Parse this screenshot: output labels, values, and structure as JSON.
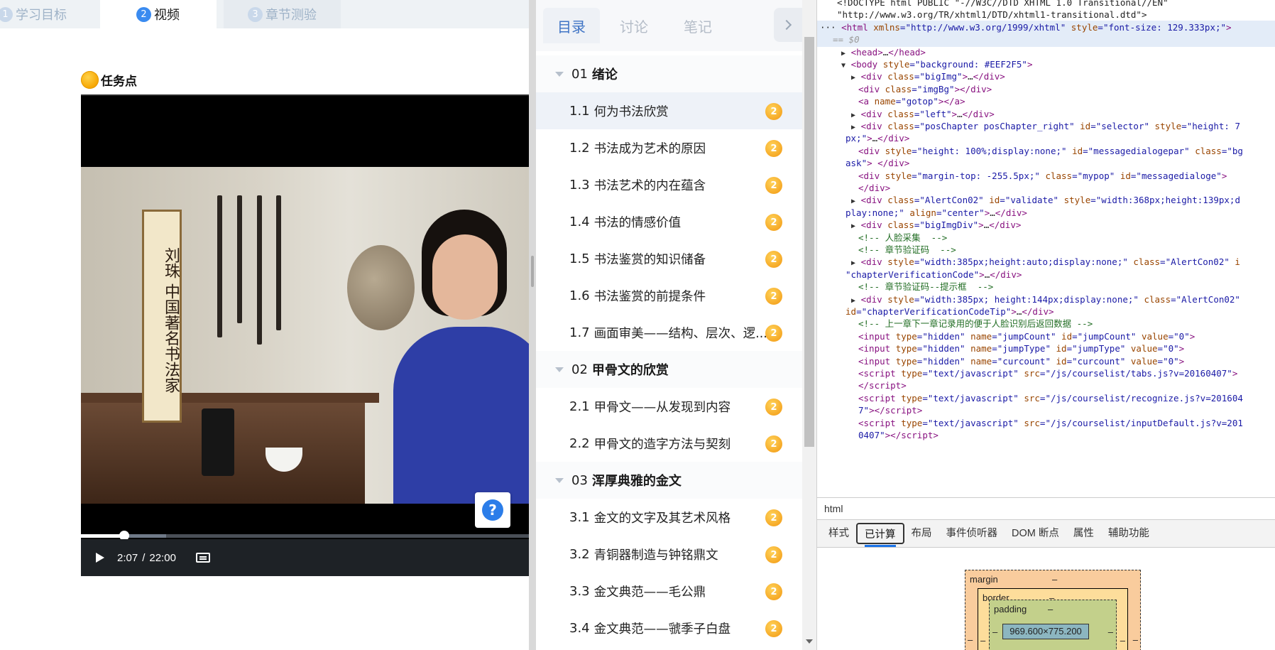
{
  "course_tabs": [
    {
      "num": "1",
      "label": "学习目标"
    },
    {
      "num": "2",
      "label": "视频"
    },
    {
      "num": "3",
      "label": "章节测验"
    }
  ],
  "task_point": {
    "label": "任务点"
  },
  "video_scroll_text": "刘珠 中国著名书法家",
  "player": {
    "current_time": "2:07",
    "separator": "/",
    "duration": "22:00",
    "played_fraction": 0.096,
    "buffered_fraction": 0.19,
    "help_label": "?",
    "icons": {
      "play": "play-icon",
      "subtitles": "subtitles-icon",
      "help": "help-icon"
    }
  },
  "catalog": {
    "tabs": [
      "目录",
      "讨论",
      "笔记"
    ],
    "active_tab": 0,
    "next_icon": "chevron-right-icon",
    "items": [
      {
        "type": "chapter",
        "num": "01",
        "name": "绪论"
      },
      {
        "type": "lesson",
        "num": "1.1",
        "name": "何为书法欣赏",
        "badge": "2",
        "active": true
      },
      {
        "type": "lesson",
        "num": "1.2",
        "name": "书法成为艺术的原因",
        "badge": "2"
      },
      {
        "type": "lesson",
        "num": "1.3",
        "name": "书法艺术的内在蕴含",
        "badge": "2"
      },
      {
        "type": "lesson",
        "num": "1.4",
        "name": "书法的情感价值",
        "badge": "2"
      },
      {
        "type": "lesson",
        "num": "1.5",
        "name": "书法鉴赏的知识储备",
        "badge": "2"
      },
      {
        "type": "lesson",
        "num": "1.6",
        "name": "书法鉴赏的前提条件",
        "badge": "2"
      },
      {
        "type": "lesson",
        "num": "1.7",
        "name": "画面审美——结构、层次、逻...",
        "badge": "2"
      },
      {
        "type": "chapter",
        "num": "02",
        "name": "甲骨文的欣赏"
      },
      {
        "type": "lesson",
        "num": "2.1",
        "name": "甲骨文——从发现到内容",
        "badge": "2"
      },
      {
        "type": "lesson",
        "num": "2.2",
        "name": "甲骨文的造字方法与契刻",
        "badge": "2"
      },
      {
        "type": "chapter",
        "num": "03",
        "name": "浑厚典雅的金文"
      },
      {
        "type": "lesson",
        "num": "3.1",
        "name": "金文的文字及其艺术风格",
        "badge": "2"
      },
      {
        "type": "lesson",
        "num": "3.2",
        "name": "青铜器制造与钟铭鼎文",
        "badge": "2"
      },
      {
        "type": "lesson",
        "num": "3.3",
        "name": "金文典范——毛公鼎",
        "badge": "2"
      },
      {
        "type": "lesson",
        "num": "3.4",
        "name": "金文典范——虢季子白盘",
        "badge": "2"
      }
    ]
  },
  "devtools": {
    "lines": [
      {
        "indent": 28,
        "html": "<span class='txt'>&lt;!DOCTYPE html PUBLIC \"-//W3C//DTD XHTML 1.0 Transitional//EN\"</span>"
      },
      {
        "indent": 28,
        "html": "<span class='txt'>\"http://www.w3.org/TR/xhtml1/DTD/xhtml1-transitional.dtd\"&gt;</span>"
      },
      {
        "indent": 4,
        "sel": true,
        "html": "<span class='txt'>··· </span><span class='tag'>&lt;html</span> <span class='attr'>xmlns</span>=<span class='val'>\"http://www.w3.org/1999/xhtml\"</span> <span class='attr'>style</span>=<span class='val'>\"font-size: 129.333px;\"</span><span class='tag'>&gt;</span>"
      },
      {
        "indent": 22,
        "sel": true,
        "html": "<span class='eqs'>== $0</span>"
      },
      {
        "indent": 34,
        "html": "<span class='tri'>▶</span> <span class='tag'>&lt;head&gt;</span><span class='txt'>…</span><span class='tag'>&lt;/head&gt;</span>"
      },
      {
        "indent": 34,
        "html": "<span class='tri'>▼</span> <span class='tag'>&lt;body</span> <span class='attr'>style</span>=<span class='val'>\"background: #EEF2F5\"</span><span class='tag'>&gt;</span>"
      },
      {
        "indent": 48,
        "html": "<span class='tri'>▶</span> <span class='tag'>&lt;div</span> <span class='attr'>class</span>=<span class='val'>\"bigImg\"</span><span class='tag'>&gt;</span><span class='txt'>…</span><span class='tag'>&lt;/div&gt;</span>"
      },
      {
        "indent": 58,
        "html": "<span class='tag'>&lt;div</span> <span class='attr'>class</span>=<span class='val'>\"imgBg\"</span><span class='tag'>&gt;&lt;/div&gt;</span>"
      },
      {
        "indent": 58,
        "html": "<span class='tag'>&lt;a</span> <span class='attr'>name</span>=<span class='val'>\"gotop\"</span><span class='tag'>&gt;&lt;/a&gt;</span>"
      },
      {
        "indent": 48,
        "html": "<span class='tri'>▶</span> <span class='tag'>&lt;div</span> <span class='attr'>class</span>=<span class='val'>\"left\"</span><span class='tag'>&gt;</span><span class='txt'>…</span><span class='tag'>&lt;/div&gt;</span>"
      },
      {
        "indent": 48,
        "html": "<span class='tri'>▶</span> <span class='tag'>&lt;div</span> <span class='attr'>class</span>=<span class='val'>\"posChapter posChapter_right\"</span> <span class='attr'>id</span>=<span class='val'>\"selector\"</span> <span class='attr'>style</span>=<span class='val'>\"height: 7</span>"
      },
      {
        "indent": 40,
        "html": "<span class='val'>px;\"</span><span class='tag'>&gt;</span><span class='txt'>…</span><span class='tag'>&lt;/div&gt;</span>"
      },
      {
        "indent": 58,
        "html": "<span class='tag'>&lt;div</span> <span class='attr'>style</span>=<span class='val'>\"height: 100%;display:none;\"</span> <span class='attr'>id</span>=<span class='val'>\"messagedialogepar\"</span> <span class='attr'>class</span>=<span class='val'>\"bg</span>"
      },
      {
        "indent": 40,
        "html": "<span class='val'>ask\"</span><span class='tag'>&gt; &lt;/div&gt;</span>"
      },
      {
        "indent": 58,
        "html": "<span class='tag'>&lt;div</span> <span class='attr'>style</span>=<span class='val'>\"margin-top: -255.5px;\"</span> <span class='attr'>class</span>=<span class='val'>\"mypop\"</span> <span class='attr'>id</span>=<span class='val'>\"messagedialoge\"</span><span class='tag'>&gt;</span>"
      },
      {
        "indent": 58,
        "html": "<span class='tag'>&lt;/div&gt;</span>"
      },
      {
        "indent": 48,
        "html": "<span class='tri'>▶</span> <span class='tag'>&lt;div</span> <span class='attr'>class</span>=<span class='val'>\"AlertCon02\"</span> <span class='attr'>id</span>=<span class='val'>\"validate\"</span> <span class='attr'>style</span>=<span class='val'>\"width:368px;height:139px;d</span>"
      },
      {
        "indent": 40,
        "html": "<span class='val'>play:none;\"</span> <span class='attr'>align</span>=<span class='val'>\"center\"</span><span class='tag'>&gt;</span><span class='txt'>…</span><span class='tag'>&lt;/div&gt;</span>"
      },
      {
        "indent": 48,
        "html": "<span class='tri'>▶</span> <span class='tag'>&lt;div</span> <span class='attr'>class</span>=<span class='val'>\"bigImgDiv\"</span><span class='tag'>&gt;</span><span class='txt'>…</span><span class='tag'>&lt;/div&gt;</span>"
      },
      {
        "indent": 58,
        "html": "<span class='cmt'>&lt;!-- 人脸采集  --&gt;</span>"
      },
      {
        "indent": 58,
        "html": "<span class='cmt'>&lt;!-- 章节验证码  --&gt;</span>"
      },
      {
        "indent": 48,
        "html": "<span class='tri'>▶</span> <span class='tag'>&lt;div</span> <span class='attr'>style</span>=<span class='val'>\"width:385px;height:auto;display:none;\"</span> <span class='attr'>class</span>=<span class='val'>\"AlertCon02\"</span> <span class='attr'>i</span>"
      },
      {
        "indent": 40,
        "html": "<span class='val'>\"chapterVerificationCode\"</span><span class='tag'>&gt;</span><span class='txt'>…</span><span class='tag'>&lt;/div&gt;</span>"
      },
      {
        "indent": 58,
        "html": "<span class='cmt'>&lt;!-- 章节验证码--提示框  --&gt;</span>"
      },
      {
        "indent": 48,
        "html": "<span class='tri'>▶</span> <span class='tag'>&lt;div</span> <span class='attr'>style</span>=<span class='val'>\"width:385px; height:144px;display:none;\"</span> <span class='attr'>class</span>=<span class='val'>\"AlertCon02\"</span>"
      },
      {
        "indent": 40,
        "html": "<span class='attr'>id</span>=<span class='val'>\"chapterVerificationCodeTip\"</span><span class='tag'>&gt;</span><span class='txt'>…</span><span class='tag'>&lt;/div&gt;</span>"
      },
      {
        "indent": 58,
        "html": "<span class='cmt'>&lt;!-- 上一章下一章记录用的便于人脸识别后返回数据 --&gt;</span>"
      },
      {
        "indent": 58,
        "html": "<span class='tag'>&lt;input</span> <span class='attr'>type</span>=<span class='val'>\"hidden\"</span> <span class='attr'>name</span>=<span class='val'>\"jumpCount\"</span> <span class='attr'>id</span>=<span class='val'>\"jumpCount\"</span> <span class='attr'>value</span>=<span class='val'>\"0\"</span><span class='tag'>&gt;</span>"
      },
      {
        "indent": 58,
        "html": "<span class='tag'>&lt;input</span> <span class='attr'>type</span>=<span class='val'>\"hidden\"</span> <span class='attr'>name</span>=<span class='val'>\"jumpType\"</span> <span class='attr'>id</span>=<span class='val'>\"jumpType\"</span> <span class='attr'>value</span>=<span class='val'>\"0\"</span><span class='tag'>&gt;</span>"
      },
      {
        "indent": 58,
        "html": "<span class='tag'>&lt;input</span> <span class='attr'>type</span>=<span class='val'>\"hidden\"</span> <span class='attr'>name</span>=<span class='val'>\"curcount\"</span> <span class='attr'>id</span>=<span class='val'>\"curcount\"</span> <span class='attr'>value</span>=<span class='val'>\"0\"</span><span class='tag'>&gt;</span>"
      },
      {
        "indent": 58,
        "html": "<span class='tag'>&lt;script</span> <span class='attr'>type</span>=<span class='val'>\"text/javascript\"</span> <span class='attr'>src</span>=<span class='val'>\"/js/courselist/tabs.js?v=20160407\"</span><span class='tag'>&gt;</span>"
      },
      {
        "indent": 58,
        "html": "<span class='tag'>&lt;/script&gt;</span>"
      },
      {
        "indent": 58,
        "html": "<span class='tag'>&lt;script</span> <span class='attr'>type</span>=<span class='val'>\"text/javascript\"</span> <span class='attr'>src</span>=<span class='val'>\"/js/courselist/recognize.js?v=201604</span>"
      },
      {
        "indent": 58,
        "html": "<span class='val'>7\"</span><span class='tag'>&gt;&lt;/script&gt;</span>"
      },
      {
        "indent": 58,
        "html": "<span class='tag'>&lt;script</span> <span class='attr'>type</span>=<span class='val'>\"text/javascript\"</span> <span class='attr'>src</span>=<span class='val'>\"/js/courselist/inputDefault.js?v=201</span>"
      },
      {
        "indent": 58,
        "html": "<span class='val'>0407\"</span><span class='tag'>&gt;&lt;/script&gt;</span>"
      }
    ],
    "breadcrumb": "html",
    "tabs": [
      "样式",
      "已计算",
      "布局",
      "事件侦听器",
      "DOM 断点",
      "属性",
      "辅助功能"
    ],
    "active_tab": 1,
    "box_model": {
      "margin_label": "margin",
      "border_label": "border",
      "padding_label": "padding",
      "dash": "–",
      "content_size": "969.600×775.200"
    }
  }
}
